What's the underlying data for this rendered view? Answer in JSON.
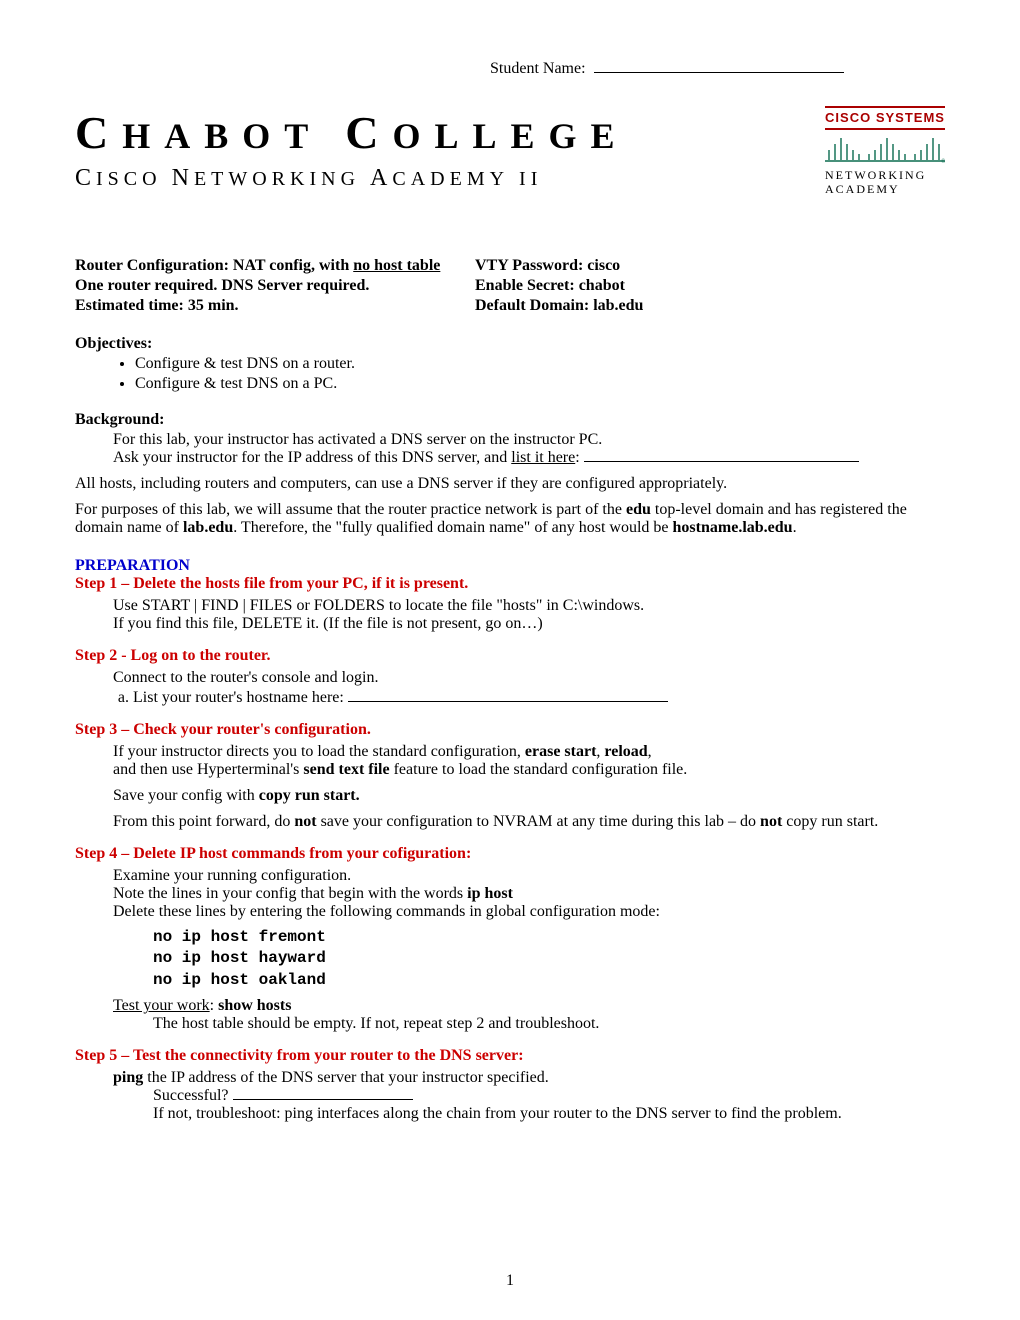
{
  "student_label": "Student Name:",
  "college": "CHABOT COLLEGE",
  "subtitle": "CISCO NETWORKING ACADEMY II",
  "logo": {
    "brand": "CISCO SYSTEMS",
    "line1": "NETWORKING",
    "line2": "ACADEMY"
  },
  "info": {
    "left1a": "Router Configuration: NAT config, with ",
    "left1b": "no host table",
    "left2": "One router required.    DNS Server required.",
    "left3": "Estimated time: 35 min.",
    "right1": "VTY Password: cisco",
    "right2": "Enable Secret: chabot",
    "right3": "Default Domain: lab.edu"
  },
  "objectives_head": "Objectives:",
  "objectives": [
    "Configure & test DNS on a router.",
    "Configure & test DNS on a PC."
  ],
  "background_head": "Background:",
  "bg1": "For this lab, your instructor has activated a DNS server on the instructor PC.",
  "bg2a": "Ask your instructor for the IP address of this DNS server, and ",
  "bg2b": "list it here",
  "bg2c": ": ",
  "bg3": "All hosts, including routers and computers, can use a DNS server if they are configured appropriately.",
  "bg4a": "For purposes of this lab, we will assume that the router practice network is part of the ",
  "bg4b": "edu",
  "bg4c": " top-level domain and has registered the domain name of ",
  "bg4d": "lab.edu",
  "bg4e": ".  Therefore, the \"fully qualified domain name\" of any host would be ",
  "bg4f": "hostname.lab.edu",
  "bg4g": ".",
  "prep": "PREPARATION",
  "step1": "Step 1 – Delete the hosts file from your PC, if it is present.",
  "s1a": "Use START | FIND | FILES or FOLDERS to locate the file \"hosts\" in C:\\windows.",
  "s1b": "If you find this file, DELETE it.  (If the file is not present, go on…)",
  "step2": "Step 2 - Log on to the router.",
  "s2a": "Connect to the router's console and login.",
  "s2b": "List your router's hostname here: ",
  "step3": "Step 3 – Check your router's configuration.",
  "s3a1": "If your instructor directs you to load the standard configuration, ",
  "s3a2": "erase start",
  "s3a3": ", ",
  "s3a4": "reload",
  "s3a5": ",",
  "s3b1": "and then use Hyperterminal's ",
  "s3b2": "send text file",
  "s3b3": " feature to load the standard configuration file.",
  "s3c1": "Save your config with ",
  "s3c2": "copy run start.",
  "s3d1": "From this point forward, do ",
  "s3d2": "not",
  "s3d3": " save your configuration to NVRAM at any time during this lab – do ",
  "s3d4": "not",
  "s3d5": " copy run start.",
  "step4": "Step 4 – Delete IP host commands from your cofiguration:",
  "s4a": "Examine your running configuration.",
  "s4b1": "Note the lines in your config that begin with the words ",
  "s4b2": "ip host",
  "s4c": "Delete these lines by entering the following commands in global configuration mode:",
  "cmds": [
    "no ip host fremont",
    "no ip host hayward",
    "no ip host oakland"
  ],
  "s4d1": "Test your work",
  "s4d2": ": ",
  "s4d3": "show hosts",
  "s4e": "The host table should be empty.  If not, repeat step 2 and troubleshoot.",
  "step5": "Step 5 – Test the connectivity from your router to the DNS server:",
  "s5a1": "ping",
  "s5a2": " the IP address of the DNS server that your instructor specified.",
  "s5b": "Successful? ",
  "s5c": "If not, troubleshoot: ping interfaces along the chain from your router to the DNS server to find the problem.",
  "page_number": "1"
}
